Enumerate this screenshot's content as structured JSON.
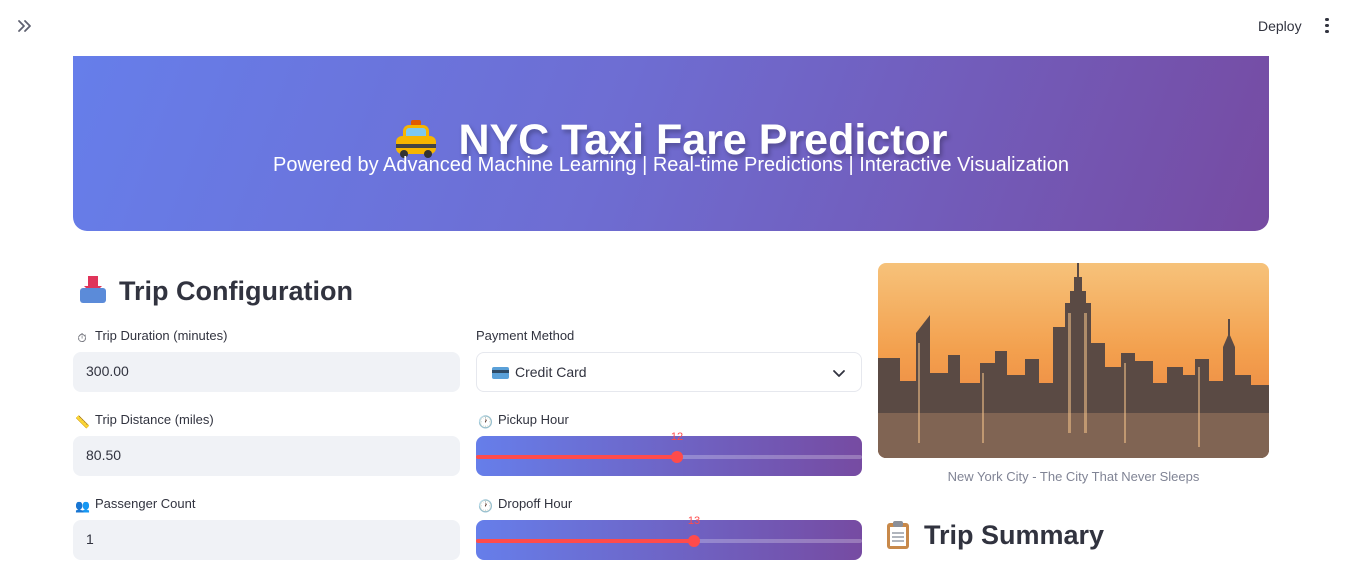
{
  "toolbar": {
    "deploy_label": "Deploy"
  },
  "hero": {
    "title": "NYC Taxi Fare Predictor",
    "subtitle": "Powered by Advanced Machine Learning | Real-time Predictions | Interactive Visualization"
  },
  "trip_config": {
    "heading": "Trip Configuration",
    "duration": {
      "label": "Trip Duration (minutes)",
      "value": "300.00"
    },
    "distance": {
      "label": "Trip Distance (miles)",
      "value": "80.50"
    },
    "passengers": {
      "label": "Passenger Count",
      "value": "1"
    },
    "payment": {
      "label": "Payment Method",
      "value": "Credit Card"
    },
    "pickup": {
      "label": "Pickup Hour",
      "value": "12",
      "min": 0,
      "max": 23
    },
    "dropoff": {
      "label": "Dropoff Hour",
      "value": "13",
      "min": 0,
      "max": 23
    },
    "stepper": {
      "minus": "−",
      "plus": "+"
    }
  },
  "image": {
    "caption": "New York City - The City That Never Sleeps"
  },
  "summary": {
    "heading": "Trip Summary"
  },
  "colors": {
    "accent": "#ff4b4b",
    "gradient_start": "#667eea",
    "gradient_end": "#764ba2"
  }
}
